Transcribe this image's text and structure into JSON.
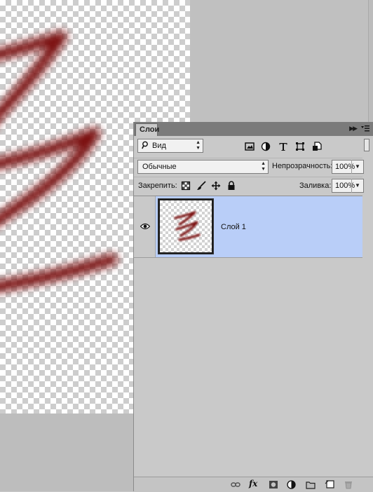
{
  "panel": {
    "tab_label": "Слои",
    "filter": {
      "selected": "Вид",
      "icons": [
        "image-filter-icon",
        "adjustment-filter-icon",
        "type-filter-icon",
        "shape-filter-icon",
        "smart-object-filter-icon"
      ]
    },
    "blend_mode": "Обычные",
    "opacity_label": "Непрозрачность:",
    "opacity_value": "100%",
    "lock_label": "Закрепить:",
    "lock_icons": [
      "lock-transparent-icon",
      "lock-image-icon",
      "lock-position-icon",
      "lock-all-icon"
    ],
    "fill_label": "Заливка:",
    "fill_value": "100%",
    "layers": [
      {
        "name": "Слой 1",
        "visible": true,
        "selected": true
      }
    ],
    "bottom_icons": [
      "link-layers-icon",
      "fx-icon",
      "add-mask-icon",
      "new-adjustment-icon",
      "new-group-icon",
      "new-layer-icon",
      "delete-layer-icon"
    ],
    "fx_text": "fx"
  },
  "colors": {
    "stroke": "#7a0a0a",
    "selected_layer": "#b9cef8",
    "panel_bg": "#c9c9c9"
  }
}
